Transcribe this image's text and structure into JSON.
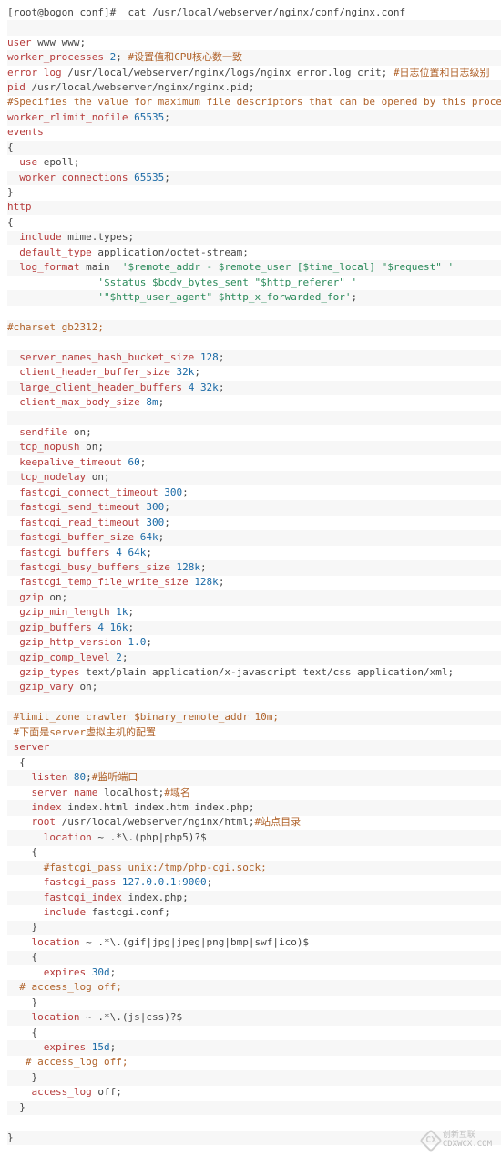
{
  "watermark": {
    "glyph": "CX",
    "line1": "创新互联",
    "line2": "CDXWCX.COM"
  },
  "lines": [
    [
      {
        "cls": "plain",
        "t": "[root@bogon conf]#  cat /usr/local/webserver/nginx/conf/nginx.conf"
      }
    ],
    [],
    [
      {
        "cls": "kw",
        "t": "user"
      },
      {
        "cls": "plain",
        "t": " www www;"
      }
    ],
    [
      {
        "cls": "kw",
        "t": "worker_processes"
      },
      {
        "cls": "plain",
        "t": " "
      },
      {
        "cls": "num",
        "t": "2"
      },
      {
        "cls": "plain",
        "t": "; "
      },
      {
        "cls": "cmt",
        "t": "#设置值和CPU核心数一致"
      }
    ],
    [
      {
        "cls": "kw",
        "t": "error_log"
      },
      {
        "cls": "plain",
        "t": " /usr/local/webserver/nginx/logs/nginx_error.log crit; "
      },
      {
        "cls": "cmt",
        "t": "#日志位置和日志级别"
      }
    ],
    [
      {
        "cls": "kw",
        "t": "pid"
      },
      {
        "cls": "plain",
        "t": " /usr/local/webserver/nginx/nginx.pid;"
      }
    ],
    [
      {
        "cls": "cmt",
        "t": "#Specifies the value for maximum file descriptors that can be opened by this process."
      }
    ],
    [
      {
        "cls": "kw",
        "t": "worker_rlimit_nofile"
      },
      {
        "cls": "plain",
        "t": " "
      },
      {
        "cls": "num",
        "t": "65535"
      },
      {
        "cls": "plain",
        "t": ";"
      }
    ],
    [
      {
        "cls": "kw",
        "t": "events"
      }
    ],
    [
      {
        "cls": "plain",
        "t": "{"
      }
    ],
    [
      {
        "cls": "plain",
        "t": "  "
      },
      {
        "cls": "kw",
        "t": "use"
      },
      {
        "cls": "plain",
        "t": " epoll;"
      }
    ],
    [
      {
        "cls": "plain",
        "t": "  "
      },
      {
        "cls": "kw",
        "t": "worker_connections"
      },
      {
        "cls": "plain",
        "t": " "
      },
      {
        "cls": "num",
        "t": "65535"
      },
      {
        "cls": "plain",
        "t": ";"
      }
    ],
    [
      {
        "cls": "plain",
        "t": "}"
      }
    ],
    [
      {
        "cls": "kw",
        "t": "http"
      }
    ],
    [
      {
        "cls": "plain",
        "t": "{"
      }
    ],
    [
      {
        "cls": "plain",
        "t": "  "
      },
      {
        "cls": "kw",
        "t": "include"
      },
      {
        "cls": "plain",
        "t": " mime.types;"
      }
    ],
    [
      {
        "cls": "plain",
        "t": "  "
      },
      {
        "cls": "kw",
        "t": "default_type"
      },
      {
        "cls": "plain",
        "t": " application/octet-stream;"
      }
    ],
    [
      {
        "cls": "plain",
        "t": "  "
      },
      {
        "cls": "kw",
        "t": "log_format"
      },
      {
        "cls": "plain",
        "t": " main  "
      },
      {
        "cls": "str",
        "t": "'$remote_addr - $remote_user [$time_local] \"$request\" '"
      }
    ],
    [
      {
        "cls": "plain",
        "t": "               "
      },
      {
        "cls": "str",
        "t": "'$status $body_bytes_sent \"$http_referer\" '"
      }
    ],
    [
      {
        "cls": "plain",
        "t": "               "
      },
      {
        "cls": "str",
        "t": "'\"$http_user_agent\" $http_x_forwarded_for'"
      },
      {
        "cls": "plain",
        "t": ";"
      }
    ],
    [],
    [
      {
        "cls": "cmt",
        "t": "#charset gb2312;"
      }
    ],
    [],
    [
      {
        "cls": "plain",
        "t": "  "
      },
      {
        "cls": "kw",
        "t": "server_names_hash_bucket_size"
      },
      {
        "cls": "plain",
        "t": " "
      },
      {
        "cls": "num",
        "t": "128"
      },
      {
        "cls": "plain",
        "t": ";"
      }
    ],
    [
      {
        "cls": "plain",
        "t": "  "
      },
      {
        "cls": "kw",
        "t": "client_header_buffer_size"
      },
      {
        "cls": "plain",
        "t": " "
      },
      {
        "cls": "num",
        "t": "32k"
      },
      {
        "cls": "plain",
        "t": ";"
      }
    ],
    [
      {
        "cls": "plain",
        "t": "  "
      },
      {
        "cls": "kw",
        "t": "large_client_header_buffers"
      },
      {
        "cls": "plain",
        "t": " "
      },
      {
        "cls": "num",
        "t": "4"
      },
      {
        "cls": "plain",
        "t": " "
      },
      {
        "cls": "num",
        "t": "32k"
      },
      {
        "cls": "plain",
        "t": ";"
      }
    ],
    [
      {
        "cls": "plain",
        "t": "  "
      },
      {
        "cls": "kw",
        "t": "client_max_body_size"
      },
      {
        "cls": "plain",
        "t": " "
      },
      {
        "cls": "num",
        "t": "8m"
      },
      {
        "cls": "plain",
        "t": ";"
      }
    ],
    [],
    [
      {
        "cls": "plain",
        "t": "  "
      },
      {
        "cls": "kw",
        "t": "sendfile"
      },
      {
        "cls": "plain",
        "t": " on;"
      }
    ],
    [
      {
        "cls": "plain",
        "t": "  "
      },
      {
        "cls": "kw",
        "t": "tcp_nopush"
      },
      {
        "cls": "plain",
        "t": " on;"
      }
    ],
    [
      {
        "cls": "plain",
        "t": "  "
      },
      {
        "cls": "kw",
        "t": "keepalive_timeout"
      },
      {
        "cls": "plain",
        "t": " "
      },
      {
        "cls": "num",
        "t": "60"
      },
      {
        "cls": "plain",
        "t": ";"
      }
    ],
    [
      {
        "cls": "plain",
        "t": "  "
      },
      {
        "cls": "kw",
        "t": "tcp_nodelay"
      },
      {
        "cls": "plain",
        "t": " on;"
      }
    ],
    [
      {
        "cls": "plain",
        "t": "  "
      },
      {
        "cls": "kw",
        "t": "fastcgi_connect_timeout"
      },
      {
        "cls": "plain",
        "t": " "
      },
      {
        "cls": "num",
        "t": "300"
      },
      {
        "cls": "plain",
        "t": ";"
      }
    ],
    [
      {
        "cls": "plain",
        "t": "  "
      },
      {
        "cls": "kw",
        "t": "fastcgi_send_timeout"
      },
      {
        "cls": "plain",
        "t": " "
      },
      {
        "cls": "num",
        "t": "300"
      },
      {
        "cls": "plain",
        "t": ";"
      }
    ],
    [
      {
        "cls": "plain",
        "t": "  "
      },
      {
        "cls": "kw",
        "t": "fastcgi_read_timeout"
      },
      {
        "cls": "plain",
        "t": " "
      },
      {
        "cls": "num",
        "t": "300"
      },
      {
        "cls": "plain",
        "t": ";"
      }
    ],
    [
      {
        "cls": "plain",
        "t": "  "
      },
      {
        "cls": "kw",
        "t": "fastcgi_buffer_size"
      },
      {
        "cls": "plain",
        "t": " "
      },
      {
        "cls": "num",
        "t": "64k"
      },
      {
        "cls": "plain",
        "t": ";"
      }
    ],
    [
      {
        "cls": "plain",
        "t": "  "
      },
      {
        "cls": "kw",
        "t": "fastcgi_buffers"
      },
      {
        "cls": "plain",
        "t": " "
      },
      {
        "cls": "num",
        "t": "4"
      },
      {
        "cls": "plain",
        "t": " "
      },
      {
        "cls": "num",
        "t": "64k"
      },
      {
        "cls": "plain",
        "t": ";"
      }
    ],
    [
      {
        "cls": "plain",
        "t": "  "
      },
      {
        "cls": "kw",
        "t": "fastcgi_busy_buffers_size"
      },
      {
        "cls": "plain",
        "t": " "
      },
      {
        "cls": "num",
        "t": "128k"
      },
      {
        "cls": "plain",
        "t": ";"
      }
    ],
    [
      {
        "cls": "plain",
        "t": "  "
      },
      {
        "cls": "kw",
        "t": "fastcgi_temp_file_write_size"
      },
      {
        "cls": "plain",
        "t": " "
      },
      {
        "cls": "num",
        "t": "128k"
      },
      {
        "cls": "plain",
        "t": ";"
      }
    ],
    [
      {
        "cls": "plain",
        "t": "  "
      },
      {
        "cls": "kw",
        "t": "gzip"
      },
      {
        "cls": "plain",
        "t": " on;"
      }
    ],
    [
      {
        "cls": "plain",
        "t": "  "
      },
      {
        "cls": "kw",
        "t": "gzip_min_length"
      },
      {
        "cls": "plain",
        "t": " "
      },
      {
        "cls": "num",
        "t": "1k"
      },
      {
        "cls": "plain",
        "t": ";"
      }
    ],
    [
      {
        "cls": "plain",
        "t": "  "
      },
      {
        "cls": "kw",
        "t": "gzip_buffers"
      },
      {
        "cls": "plain",
        "t": " "
      },
      {
        "cls": "num",
        "t": "4"
      },
      {
        "cls": "plain",
        "t": " "
      },
      {
        "cls": "num",
        "t": "16k"
      },
      {
        "cls": "plain",
        "t": ";"
      }
    ],
    [
      {
        "cls": "plain",
        "t": "  "
      },
      {
        "cls": "kw",
        "t": "gzip_http_version"
      },
      {
        "cls": "plain",
        "t": " "
      },
      {
        "cls": "num",
        "t": "1.0"
      },
      {
        "cls": "plain",
        "t": ";"
      }
    ],
    [
      {
        "cls": "plain",
        "t": "  "
      },
      {
        "cls": "kw",
        "t": "gzip_comp_level"
      },
      {
        "cls": "plain",
        "t": " "
      },
      {
        "cls": "num",
        "t": "2"
      },
      {
        "cls": "plain",
        "t": ";"
      }
    ],
    [
      {
        "cls": "plain",
        "t": "  "
      },
      {
        "cls": "kw",
        "t": "gzip_types"
      },
      {
        "cls": "plain",
        "t": " text/plain application/x-javascript text/css application/xml;"
      }
    ],
    [
      {
        "cls": "plain",
        "t": "  "
      },
      {
        "cls": "kw",
        "t": "gzip_vary"
      },
      {
        "cls": "plain",
        "t": " on;"
      }
    ],
    [],
    [
      {
        "cls": "plain",
        "t": " "
      },
      {
        "cls": "cmt",
        "t": "#limit_zone crawler $binary_remote_addr 10m;"
      }
    ],
    [
      {
        "cls": "plain",
        "t": " "
      },
      {
        "cls": "cmt",
        "t": "#下面是server虚拟主机的配置"
      }
    ],
    [
      {
        "cls": "plain",
        "t": " "
      },
      {
        "cls": "kw",
        "t": "server"
      }
    ],
    [
      {
        "cls": "plain",
        "t": "  {"
      }
    ],
    [
      {
        "cls": "plain",
        "t": "    "
      },
      {
        "cls": "kw",
        "t": "listen"
      },
      {
        "cls": "plain",
        "t": " "
      },
      {
        "cls": "num",
        "t": "80"
      },
      {
        "cls": "plain",
        "t": ";"
      },
      {
        "cls": "cmt",
        "t": "#监听端口"
      }
    ],
    [
      {
        "cls": "plain",
        "t": "    "
      },
      {
        "cls": "kw",
        "t": "server_name"
      },
      {
        "cls": "plain",
        "t": " localhost;"
      },
      {
        "cls": "cmt",
        "t": "#域名"
      }
    ],
    [
      {
        "cls": "plain",
        "t": "    "
      },
      {
        "cls": "kw",
        "t": "index"
      },
      {
        "cls": "plain",
        "t": " index.html index.htm index.php;"
      }
    ],
    [
      {
        "cls": "plain",
        "t": "    "
      },
      {
        "cls": "kw",
        "t": "root"
      },
      {
        "cls": "plain",
        "t": " /usr/local/webserver/nginx/html;"
      },
      {
        "cls": "cmt",
        "t": "#站点目录"
      }
    ],
    [
      {
        "cls": "plain",
        "t": "      "
      },
      {
        "cls": "kw",
        "t": "location"
      },
      {
        "cls": "plain",
        "t": " ~ .*\\.(php|php5)?$"
      }
    ],
    [
      {
        "cls": "plain",
        "t": "    {"
      }
    ],
    [
      {
        "cls": "plain",
        "t": "      "
      },
      {
        "cls": "cmt",
        "t": "#fastcgi_pass unix:/tmp/php-cgi.sock;"
      }
    ],
    [
      {
        "cls": "plain",
        "t": "      "
      },
      {
        "cls": "kw",
        "t": "fastcgi_pass"
      },
      {
        "cls": "plain",
        "t": " "
      },
      {
        "cls": "num",
        "t": "127.0.0.1:9000"
      },
      {
        "cls": "plain",
        "t": ";"
      }
    ],
    [
      {
        "cls": "plain",
        "t": "      "
      },
      {
        "cls": "kw",
        "t": "fastcgi_index"
      },
      {
        "cls": "plain",
        "t": " index.php;"
      }
    ],
    [
      {
        "cls": "plain",
        "t": "      "
      },
      {
        "cls": "kw",
        "t": "include"
      },
      {
        "cls": "plain",
        "t": " fastcgi.conf;"
      }
    ],
    [
      {
        "cls": "plain",
        "t": "    }"
      }
    ],
    [
      {
        "cls": "plain",
        "t": "    "
      },
      {
        "cls": "kw",
        "t": "location"
      },
      {
        "cls": "plain",
        "t": " ~ .*\\.(gif|jpg|jpeg|png|bmp|swf|ico)$"
      }
    ],
    [
      {
        "cls": "plain",
        "t": "    {"
      }
    ],
    [
      {
        "cls": "plain",
        "t": "      "
      },
      {
        "cls": "kw",
        "t": "expires"
      },
      {
        "cls": "plain",
        "t": " "
      },
      {
        "cls": "num",
        "t": "30d"
      },
      {
        "cls": "plain",
        "t": ";"
      }
    ],
    [
      {
        "cls": "plain",
        "t": "  "
      },
      {
        "cls": "cmt",
        "t": "# access_log off;"
      }
    ],
    [
      {
        "cls": "plain",
        "t": "    }"
      }
    ],
    [
      {
        "cls": "plain",
        "t": "    "
      },
      {
        "cls": "kw",
        "t": "location"
      },
      {
        "cls": "plain",
        "t": " ~ .*\\.(js|css)?$"
      }
    ],
    [
      {
        "cls": "plain",
        "t": "    {"
      }
    ],
    [
      {
        "cls": "plain",
        "t": "      "
      },
      {
        "cls": "kw",
        "t": "expires"
      },
      {
        "cls": "plain",
        "t": " "
      },
      {
        "cls": "num",
        "t": "15d"
      },
      {
        "cls": "plain",
        "t": ";"
      }
    ],
    [
      {
        "cls": "plain",
        "t": "   "
      },
      {
        "cls": "cmt",
        "t": "# access_log off;"
      }
    ],
    [
      {
        "cls": "plain",
        "t": "    }"
      }
    ],
    [
      {
        "cls": "plain",
        "t": "    "
      },
      {
        "cls": "kw",
        "t": "access_log"
      },
      {
        "cls": "plain",
        "t": " off;"
      }
    ],
    [
      {
        "cls": "plain",
        "t": "  }"
      }
    ],
    [],
    [
      {
        "cls": "plain",
        "t": "}"
      }
    ]
  ]
}
